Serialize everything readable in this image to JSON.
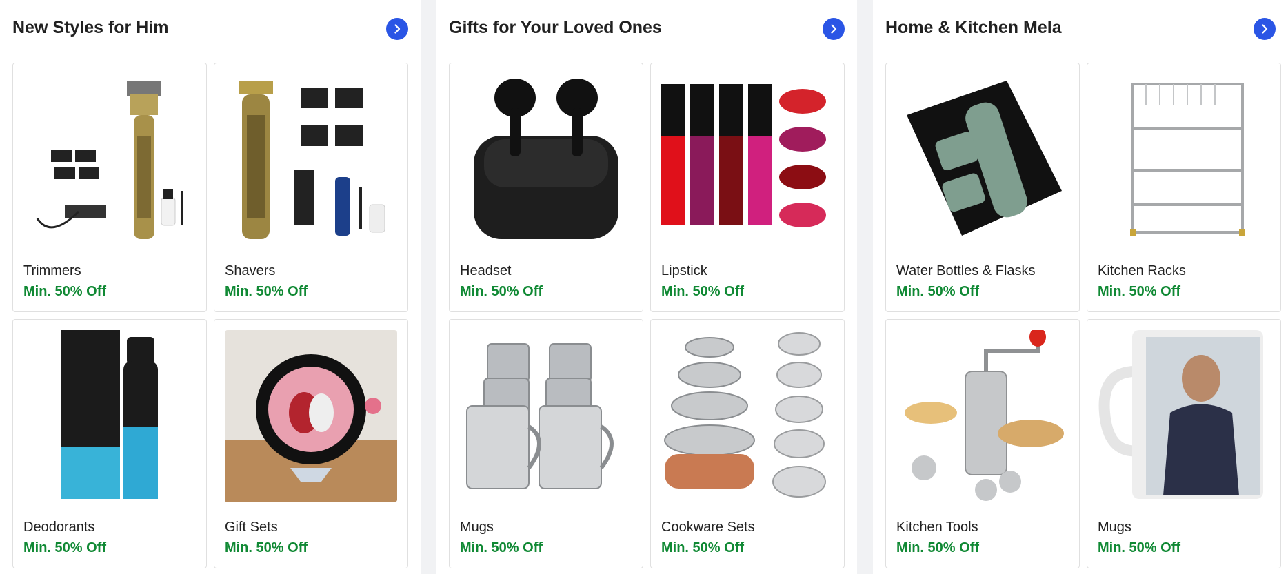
{
  "colors": {
    "accent": "#2a55e5",
    "offer": "#108934",
    "text": "#212121",
    "border": "#e0e0e0",
    "background": "#f1f2f4"
  },
  "panels": [
    {
      "title": "New Styles for Him",
      "items": [
        {
          "label": "Trimmers",
          "offer": "Min. 50% Off",
          "icon": "trimmer-icon"
        },
        {
          "label": "Shavers",
          "offer": "Min. 50% Off",
          "icon": "shaver-icon"
        },
        {
          "label": "Deodorants",
          "offer": "Min. 50% Off",
          "icon": "deodorant-icon"
        },
        {
          "label": "Gift Sets",
          "offer": "Min. 50% Off",
          "icon": "gift-set-icon"
        }
      ]
    },
    {
      "title": "Gifts for Your Loved Ones",
      "items": [
        {
          "label": "Headset",
          "offer": "Min. 50% Off",
          "icon": "earbuds-icon"
        },
        {
          "label": "Lipstick",
          "offer": "Min. 50% Off",
          "icon": "lipstick-icon"
        },
        {
          "label": "Mugs",
          "offer": "Min. 50% Off",
          "icon": "steel-mugs-icon"
        },
        {
          "label": "Cookware Sets",
          "offer": "Min. 50% Off",
          "icon": "cookware-icon"
        }
      ]
    },
    {
      "title": "Home & Kitchen Mela",
      "items": [
        {
          "label": "Water Bottles & Flasks",
          "offer": "Min. 50% Off",
          "icon": "flask-set-icon"
        },
        {
          "label": "Kitchen Racks",
          "offer": "Min. 50% Off",
          "icon": "kitchen-rack-icon"
        },
        {
          "label": "Kitchen Tools",
          "offer": "Min. 50% Off",
          "icon": "kitchen-press-icon"
        },
        {
          "label": "Mugs",
          "offer": "Min. 50% Off",
          "icon": "photo-mug-icon"
        }
      ]
    }
  ]
}
